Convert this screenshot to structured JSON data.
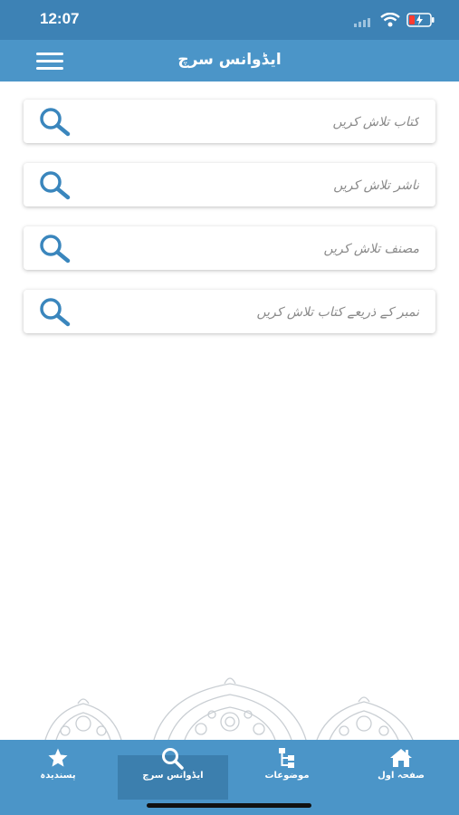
{
  "status_bar": {
    "time": "12:07"
  },
  "nav": {
    "title": "ایڈوانس سرچ"
  },
  "search_fields": [
    {
      "placeholder": "کتاب تلاش کریں"
    },
    {
      "placeholder": "ناشر تلاش کریں"
    },
    {
      "placeholder": "مصنف تلاش کریں"
    },
    {
      "placeholder": "نمبر کے ذریعے کتاب تلاش کریں"
    }
  ],
  "tabs": [
    {
      "label": "پسندیدہ",
      "icon": "star-icon"
    },
    {
      "label": "ایڈوانس سرچ",
      "icon": "search-icon",
      "active": true
    },
    {
      "label": "موضوعات",
      "icon": "sitemap-icon"
    },
    {
      "label": "صفحہ اول",
      "icon": "home-icon"
    }
  ],
  "colors": {
    "header": "#4b95c8",
    "status": "#3d82b5",
    "icon": "#3a86bd",
    "active_tab": "#3c7fae"
  }
}
